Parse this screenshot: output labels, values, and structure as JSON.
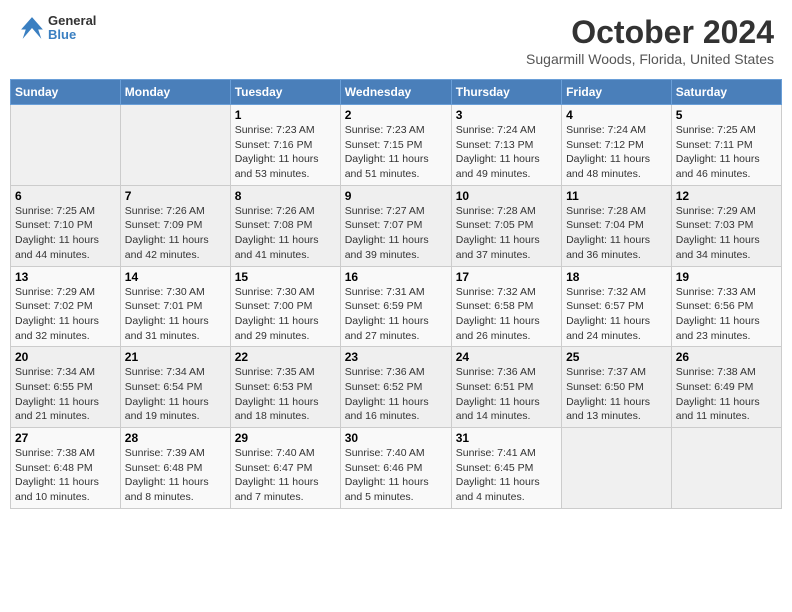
{
  "header": {
    "logo_line1": "General",
    "logo_line2": "Blue",
    "main_title": "October 2024",
    "subtitle": "Sugarmill Woods, Florida, United States"
  },
  "calendar": {
    "days_of_week": [
      "Sunday",
      "Monday",
      "Tuesday",
      "Wednesday",
      "Thursday",
      "Friday",
      "Saturday"
    ],
    "weeks": [
      [
        {
          "day": "",
          "info": ""
        },
        {
          "day": "",
          "info": ""
        },
        {
          "day": "1",
          "info": "Sunrise: 7:23 AM\nSunset: 7:16 PM\nDaylight: 11 hours and 53 minutes."
        },
        {
          "day": "2",
          "info": "Sunrise: 7:23 AM\nSunset: 7:15 PM\nDaylight: 11 hours and 51 minutes."
        },
        {
          "day": "3",
          "info": "Sunrise: 7:24 AM\nSunset: 7:13 PM\nDaylight: 11 hours and 49 minutes."
        },
        {
          "day": "4",
          "info": "Sunrise: 7:24 AM\nSunset: 7:12 PM\nDaylight: 11 hours and 48 minutes."
        },
        {
          "day": "5",
          "info": "Sunrise: 7:25 AM\nSunset: 7:11 PM\nDaylight: 11 hours and 46 minutes."
        }
      ],
      [
        {
          "day": "6",
          "info": "Sunrise: 7:25 AM\nSunset: 7:10 PM\nDaylight: 11 hours and 44 minutes."
        },
        {
          "day": "7",
          "info": "Sunrise: 7:26 AM\nSunset: 7:09 PM\nDaylight: 11 hours and 42 minutes."
        },
        {
          "day": "8",
          "info": "Sunrise: 7:26 AM\nSunset: 7:08 PM\nDaylight: 11 hours and 41 minutes."
        },
        {
          "day": "9",
          "info": "Sunrise: 7:27 AM\nSunset: 7:07 PM\nDaylight: 11 hours and 39 minutes."
        },
        {
          "day": "10",
          "info": "Sunrise: 7:28 AM\nSunset: 7:05 PM\nDaylight: 11 hours and 37 minutes."
        },
        {
          "day": "11",
          "info": "Sunrise: 7:28 AM\nSunset: 7:04 PM\nDaylight: 11 hours and 36 minutes."
        },
        {
          "day": "12",
          "info": "Sunrise: 7:29 AM\nSunset: 7:03 PM\nDaylight: 11 hours and 34 minutes."
        }
      ],
      [
        {
          "day": "13",
          "info": "Sunrise: 7:29 AM\nSunset: 7:02 PM\nDaylight: 11 hours and 32 minutes."
        },
        {
          "day": "14",
          "info": "Sunrise: 7:30 AM\nSunset: 7:01 PM\nDaylight: 11 hours and 31 minutes."
        },
        {
          "day": "15",
          "info": "Sunrise: 7:30 AM\nSunset: 7:00 PM\nDaylight: 11 hours and 29 minutes."
        },
        {
          "day": "16",
          "info": "Sunrise: 7:31 AM\nSunset: 6:59 PM\nDaylight: 11 hours and 27 minutes."
        },
        {
          "day": "17",
          "info": "Sunrise: 7:32 AM\nSunset: 6:58 PM\nDaylight: 11 hours and 26 minutes."
        },
        {
          "day": "18",
          "info": "Sunrise: 7:32 AM\nSunset: 6:57 PM\nDaylight: 11 hours and 24 minutes."
        },
        {
          "day": "19",
          "info": "Sunrise: 7:33 AM\nSunset: 6:56 PM\nDaylight: 11 hours and 23 minutes."
        }
      ],
      [
        {
          "day": "20",
          "info": "Sunrise: 7:34 AM\nSunset: 6:55 PM\nDaylight: 11 hours and 21 minutes."
        },
        {
          "day": "21",
          "info": "Sunrise: 7:34 AM\nSunset: 6:54 PM\nDaylight: 11 hours and 19 minutes."
        },
        {
          "day": "22",
          "info": "Sunrise: 7:35 AM\nSunset: 6:53 PM\nDaylight: 11 hours and 18 minutes."
        },
        {
          "day": "23",
          "info": "Sunrise: 7:36 AM\nSunset: 6:52 PM\nDaylight: 11 hours and 16 minutes."
        },
        {
          "day": "24",
          "info": "Sunrise: 7:36 AM\nSunset: 6:51 PM\nDaylight: 11 hours and 14 minutes."
        },
        {
          "day": "25",
          "info": "Sunrise: 7:37 AM\nSunset: 6:50 PM\nDaylight: 11 hours and 13 minutes."
        },
        {
          "day": "26",
          "info": "Sunrise: 7:38 AM\nSunset: 6:49 PM\nDaylight: 11 hours and 11 minutes."
        }
      ],
      [
        {
          "day": "27",
          "info": "Sunrise: 7:38 AM\nSunset: 6:48 PM\nDaylight: 11 hours and 10 minutes."
        },
        {
          "day": "28",
          "info": "Sunrise: 7:39 AM\nSunset: 6:48 PM\nDaylight: 11 hours and 8 minutes."
        },
        {
          "day": "29",
          "info": "Sunrise: 7:40 AM\nSunset: 6:47 PM\nDaylight: 11 hours and 7 minutes."
        },
        {
          "day": "30",
          "info": "Sunrise: 7:40 AM\nSunset: 6:46 PM\nDaylight: 11 hours and 5 minutes."
        },
        {
          "day": "31",
          "info": "Sunrise: 7:41 AM\nSunset: 6:45 PM\nDaylight: 11 hours and 4 minutes."
        },
        {
          "day": "",
          "info": ""
        },
        {
          "day": "",
          "info": ""
        }
      ]
    ]
  }
}
